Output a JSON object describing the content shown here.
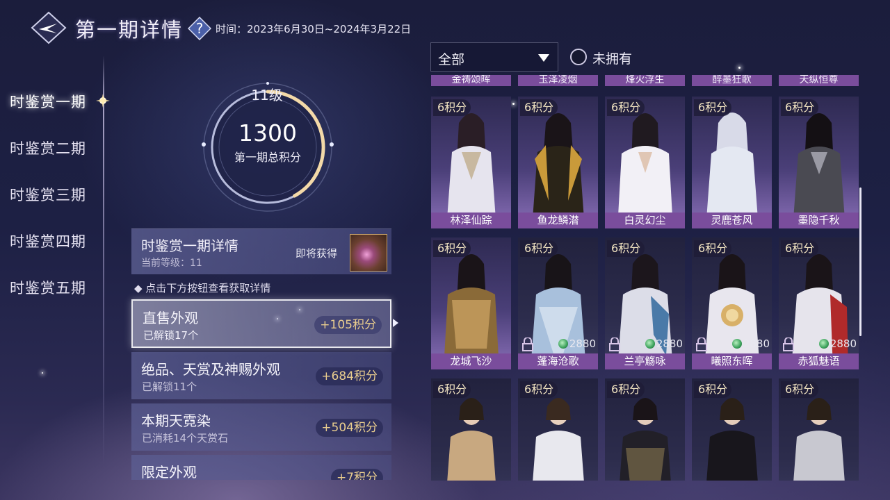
{
  "header": {
    "title": "第一期详情",
    "time_label": "时间：2023年6月30日~2024年3月22日"
  },
  "nav": {
    "items": [
      {
        "label": "时鉴赏一期"
      },
      {
        "label": "时鉴赏二期"
      },
      {
        "label": "时鉴赏三期"
      },
      {
        "label": "时鉴赏四期"
      },
      {
        "label": "时鉴赏五期"
      }
    ]
  },
  "level": {
    "level_text": "11级",
    "score": "1300",
    "score_label": "第一期总积分",
    "ring_progress": 0.42
  },
  "detail": {
    "title": "时鉴赏一期详情",
    "level_line": "当前等级：11",
    "soon": "即将获得",
    "hint": "◆ 点击下方按钮查看获取详情"
  },
  "categories": [
    {
      "name": "直售外观",
      "sub": "已解锁17个",
      "points": "+105积分"
    },
    {
      "name": "绝品、天赏及神赐外观",
      "sub": "已解锁11个",
      "points": "+684积分"
    },
    {
      "name": "本期天霓染",
      "sub": "已消耗14个天赏石",
      "points": "+504积分"
    },
    {
      "name": "限定外观",
      "sub": "",
      "points": "+7积分"
    }
  ],
  "filter": {
    "dropdown_value": "全部",
    "checkbox_label": "未拥有"
  },
  "grid": {
    "top_row": [
      "金祷颂晖",
      "玉泽凌烟",
      "烽火浮生",
      "醉墨狂歌",
      "天纵恒尊"
    ],
    "row1": [
      {
        "points": "6积分",
        "name": "林泽仙踪"
      },
      {
        "points": "6积分",
        "name": "鱼龙鳞潜"
      },
      {
        "points": "6积分",
        "name": "白灵幻尘"
      },
      {
        "points": "6积分",
        "name": "灵鹿苍风"
      },
      {
        "points": "6积分",
        "name": "墨隐千秋"
      }
    ],
    "row2": [
      {
        "points": "6积分",
        "name": "龙城飞沙",
        "price": ""
      },
      {
        "points": "6积分",
        "name": "蓬海沧歌",
        "price": "2880"
      },
      {
        "points": "6积分",
        "name": "兰亭觞咏",
        "price": "2880"
      },
      {
        "points": "6积分",
        "name": "曦照东晖",
        "price": "2880"
      },
      {
        "points": "6积分",
        "name": "赤狐魅语",
        "price": "2880"
      }
    ],
    "row3": [
      {
        "points": "6积分"
      },
      {
        "points": "6积分"
      },
      {
        "points": "6积分"
      },
      {
        "points": "6积分"
      },
      {
        "points": "6积分"
      }
    ]
  }
}
